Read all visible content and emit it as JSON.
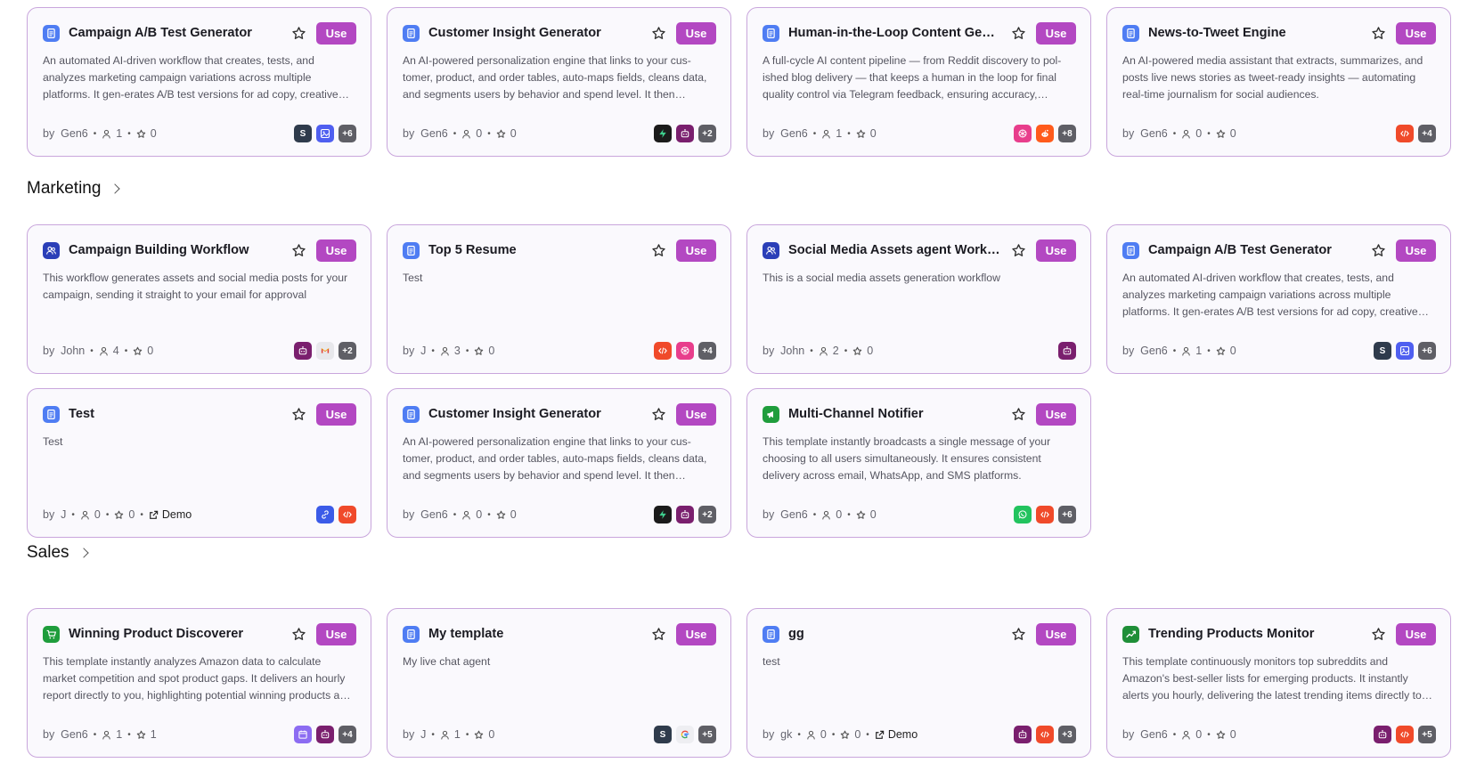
{
  "meta": {
    "by_label": "by",
    "demo_label": "Demo",
    "use_label": "Use"
  },
  "sections": {
    "marketing": {
      "title": "Marketing"
    },
    "sales": {
      "title": "Sales"
    }
  },
  "colors": {
    "accent": "#b348c2",
    "card_border": "#c9a6dc",
    "card_bg": "#faf9fd"
  },
  "top_cards": [
    {
      "title": "Campaign A/B Test Generator",
      "icon": "document-icon",
      "desc": "An automated AI-driven workflow that creates, tests, and analyzes marketing campaign variations across multiple platforms. It gen-erates A/B test versions for ad copy, creatives, and audience seg…",
      "author": "Gen6",
      "users": "1",
      "stars": "0",
      "apps": [
        {
          "icon": "s-icon",
          "label": "S"
        },
        {
          "icon": "image-icon",
          "label": ""
        }
      ],
      "more": "+6"
    },
    {
      "title": "Customer Insight Generator",
      "icon": "document-icon",
      "desc": "An AI-powered personalization engine that links to your cus-tomer, product, and order tables, auto-maps fields, cleans data, and segments users by behavior and spend level. It then gener-…",
      "author": "Gen6",
      "users": "0",
      "stars": "0",
      "apps": [
        {
          "icon": "supabase-icon",
          "label": ""
        },
        {
          "icon": "robot-icon",
          "label": ""
        }
      ],
      "more": "+2"
    },
    {
      "title": "Human-in-the-Loop Content Genera…",
      "icon": "document-icon",
      "desc": "A full-cycle AI content pipeline — from Reddit discovery to pol-ished blog delivery — that keeps a human in the loop for final quality control via Telegram feedback, ensuring accuracy, style,…",
      "author": "Gen6",
      "users": "1",
      "stars": "0",
      "apps": [
        {
          "icon": "openai-icon",
          "label": ""
        },
        {
          "icon": "reddit-icon",
          "label": ""
        }
      ],
      "more": "+8"
    },
    {
      "title": "News-to-Tweet Engine",
      "icon": "document-icon",
      "desc": "An AI-powered media assistant that extracts, summarizes, and posts live news stories as tweet-ready insights — automating real-time journalism for social audiences.",
      "author": "Gen6",
      "users": "0",
      "stars": "0",
      "apps": [
        {
          "icon": "code-icon",
          "label": ""
        }
      ],
      "more": "+4"
    }
  ],
  "marketing_cards": [
    {
      "title": "Campaign Building Workflow",
      "icon": "users-icon",
      "desc": "This workflow generates assets and social media posts for your campaign, sending it straight to your email for approval",
      "author": "John",
      "users": "4",
      "stars": "0",
      "apps": [
        {
          "icon": "robot-icon",
          "label": ""
        },
        {
          "icon": "gmail-icon",
          "label": "M"
        }
      ],
      "more": "+2"
    },
    {
      "title": "Top 5 Resume",
      "icon": "document-icon",
      "desc": "Test",
      "author": "J",
      "users": "3",
      "stars": "0",
      "apps": [
        {
          "icon": "code-icon",
          "label": ""
        },
        {
          "icon": "openai-icon",
          "label": ""
        }
      ],
      "more": "+4"
    },
    {
      "title": "Social Media Assets agent Workflow",
      "icon": "users-icon",
      "desc": "This is a social media assets generation workflow",
      "author": "John",
      "users": "2",
      "stars": "0",
      "apps": [
        {
          "icon": "robot-icon",
          "label": ""
        }
      ],
      "more": ""
    },
    {
      "title": "Campaign A/B Test Generator",
      "icon": "document-icon",
      "desc": "An automated AI-driven workflow that creates, tests, and analyzes marketing campaign variations across multiple platforms. It gen-erates A/B test versions for ad copy, creatives, and audience seg…",
      "author": "Gen6",
      "users": "1",
      "stars": "0",
      "apps": [
        {
          "icon": "s-icon",
          "label": "S"
        },
        {
          "icon": "image-icon",
          "label": ""
        }
      ],
      "more": "+6"
    },
    {
      "title": "Test",
      "icon": "document-icon",
      "desc": "Test",
      "author": "J",
      "users": "0",
      "stars": "0",
      "demo": true,
      "apps": [
        {
          "icon": "link-icon",
          "label": ""
        },
        {
          "icon": "code-icon",
          "label": ""
        }
      ],
      "more": ""
    },
    {
      "title": "Customer Insight Generator",
      "icon": "document-icon",
      "desc": "An AI-powered personalization engine that links to your cus-tomer, product, and order tables, auto-maps fields, cleans data, and segments users by behavior and spend level. It then gener-…",
      "author": "Gen6",
      "users": "0",
      "stars": "0",
      "apps": [
        {
          "icon": "supabase-icon",
          "label": ""
        },
        {
          "icon": "robot-icon",
          "label": ""
        }
      ],
      "more": "+2"
    },
    {
      "title": "Multi-Channel Notifier",
      "icon": "megaphone-icon",
      "desc": "This template instantly broadcasts a single message of your choosing to all users simultaneously. It ensures consistent delivery across email, WhatsApp, and SMS platforms.",
      "author": "Gen6",
      "users": "0",
      "stars": "0",
      "apps": [
        {
          "icon": "whatsapp-icon",
          "label": ""
        },
        {
          "icon": "code-icon",
          "label": ""
        }
      ],
      "more": "+6"
    }
  ],
  "sales_cards": [
    {
      "title": "Winning Product Discoverer",
      "icon": "cart-icon",
      "desc": "This template instantly analyzes Amazon data to calculate market competition and spot product gaps. It delivers an hourly report directly to you, highlighting potential winning products and ove…",
      "author": "Gen6",
      "users": "1",
      "stars": "1",
      "apps": [
        {
          "icon": "calendar-icon",
          "label": ""
        },
        {
          "icon": "robot-icon",
          "label": ""
        }
      ],
      "more": "+4"
    },
    {
      "title": "My template",
      "icon": "document-icon",
      "desc": "My live chat agent",
      "author": "J",
      "users": "1",
      "stars": "0",
      "apps": [
        {
          "icon": "s-icon",
          "label": "S"
        },
        {
          "icon": "google-icon",
          "label": "G"
        }
      ],
      "more": "+5"
    },
    {
      "title": "gg",
      "icon": "document-icon",
      "desc": "test",
      "author": "gk",
      "users": "0",
      "stars": "0",
      "demo": true,
      "apps": [
        {
          "icon": "robot-icon",
          "label": ""
        },
        {
          "icon": "code-icon",
          "label": ""
        }
      ],
      "more": "+3"
    },
    {
      "title": "Trending Products Monitor",
      "icon": "trend-icon",
      "desc": "This template continuously monitors top subreddits and Amazon's best-seller lists for emerging products. It instantly alerts you hourly, delivering the latest trending items directly to your…",
      "author": "Gen6",
      "users": "0",
      "stars": "0",
      "apps": [
        {
          "icon": "robot-icon",
          "label": ""
        },
        {
          "icon": "code-icon",
          "label": ""
        }
      ],
      "more": "+5"
    }
  ]
}
